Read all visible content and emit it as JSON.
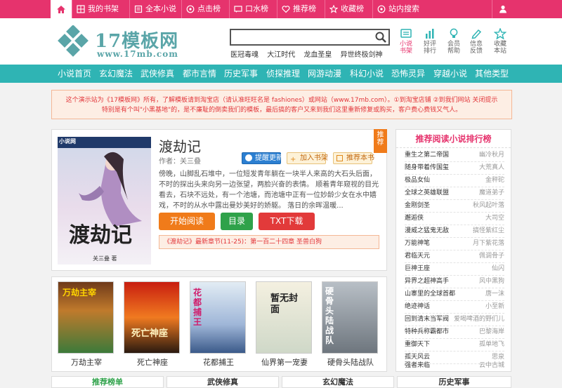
{
  "topnav": {
    "items": [
      {
        "label": "我的书架",
        "icon": "bookshelf-icon"
      },
      {
        "label": "全本小说",
        "icon": "book-icon"
      },
      {
        "label": "点击榜",
        "icon": "click-icon"
      },
      {
        "label": "口水榜",
        "icon": "chat-icon"
      },
      {
        "label": "推荐榜",
        "icon": "heart-icon"
      },
      {
        "label": "收藏榜",
        "icon": "star-icon"
      },
      {
        "label": "站内搜索",
        "icon": "search-icon"
      }
    ]
  },
  "logo": {
    "title": "17模板网",
    "url": "www.17mb.com"
  },
  "search": {
    "value": "",
    "placeholder": ""
  },
  "hotwords": [
    "医冠毒魂",
    "大江时代",
    "龙血圣皇",
    "异世终极剑神"
  ],
  "quicklinks": [
    {
      "line1": "小说",
      "line2": "书架",
      "icon": "bookshelf-icon",
      "color": "#e6336d"
    },
    {
      "line1": "好评",
      "line2": "排行",
      "icon": "bar-chart-icon",
      "color": "#2fb4b4"
    },
    {
      "line1": "会员",
      "line2": "帮助",
      "icon": "bulb-icon",
      "color": "#2fb4b4"
    },
    {
      "line1": "信息",
      "line2": "反馈",
      "icon": "pen-icon",
      "color": "#2fb4b4"
    },
    {
      "line1": "收藏",
      "line2": "本站",
      "icon": "star-icon",
      "color": "#2fb4b4"
    }
  ],
  "categories": [
    "小说首页",
    "玄幻魔法",
    "武侠修真",
    "都市言情",
    "历史军事",
    "侦探推理",
    "网游动漫",
    "科幻小说",
    "恐怖灵异",
    "穿越小说",
    "其他类型"
  ],
  "notice": {
    "line1": "这个演示站为《17模板网》所有，了解模板请到淘宝店（请认准旺旺名是 fashiones）或网站（www.17mb.com）。①到淘宝店铺 ②到我们网站 关闭提示",
    "line2": "特别是有个叫\"小黑基地\"的，是不廉耻的倒卖我们的模板，最后搞的客户又来到我们这里重新修复或购买，客户费心费钱又气人。"
  },
  "book": {
    "title": "渡劫记",
    "author": "作者：关三叠",
    "cover_title": "渡劫记",
    "cover_author": "关三叠 著",
    "cover_site": "小说网",
    "remind_label": "提醒更新",
    "shelf_label": "加入书架",
    "recommend_label": "推荐本书",
    "tag": "推荐",
    "desc": "傍晚，山脚乱石堆中，一位短发青年躺在一块半人来高的大石头后面，不时的探出头来向另一边张望，两脸兴奋的表情。 顺着青年窥视的目光看去，石块不远处，有一个池塘，而池塘中正有一位妙龄少女在水中嬉戏，不时的从水中露出曼妙美好的娇躯。 落日的余晖温暖...",
    "read_label": "开始阅读",
    "toc_label": "目录",
    "txt_label": "TXT下载",
    "latest": "《渡劫记》最新章节(11-25)：第一百二十四章 圣兽白狗"
  },
  "strip": [
    {
      "name": "万劫主宰",
      "cover_text": "万劫主宰"
    },
    {
      "name": "死亡神座",
      "cover_text": "死亡神座"
    },
    {
      "name": "花都捕王",
      "cover_text": "花都捕王"
    },
    {
      "name": "仙界第一宠妻",
      "cover_text": "暂无封面"
    },
    {
      "name": "硬骨头陆战队",
      "cover_text": "硬骨头陆战队"
    }
  ],
  "ranking": {
    "title": "推荐阅读小说排行榜",
    "rows": [
      {
        "title": "重生之第二帝国",
        "author": "幽冷秋月"
      },
      {
        "title": "随身带着传国玺",
        "author": "大荒真人"
      },
      {
        "title": "极品女仙",
        "author": "金秤砣"
      },
      {
        "title": "全球之英雄联盟",
        "author": "魔道弟子"
      },
      {
        "title": "金刚剑圣",
        "author": "秋风起叶落"
      },
      {
        "title": "邂逅侠",
        "author": "大司空"
      },
      {
        "title": "漫威之猛鬼无敌",
        "author": "搞怪紫红尘"
      },
      {
        "title": "万能神笔",
        "author": "月下紫花落"
      },
      {
        "title": "君临天元",
        "author": "佩调骨子"
      },
      {
        "title": "巨神王座",
        "author": "仙闪"
      },
      {
        "title": "异界之超神高手",
        "author": "风中黑狗"
      },
      {
        "title": "山寨里的全球首都",
        "author": "唐一沫"
      },
      {
        "title": "绝迹神话",
        "author": "小至新"
      },
      {
        "title": "回到清末当军阀",
        "author": "爱喝啤酒的野们儿"
      },
      {
        "title": "特种兵称霸都市",
        "author": "巴黎海岸"
      },
      {
        "title": "重御天下",
        "author": "孤单地飞"
      },
      {
        "title": "孤天风云",
        "author": "思泉"
      },
      {
        "title": "强者来临",
        "author": "云中古城"
      }
    ]
  },
  "bottom_tabs": [
    "推荐榜单",
    "武侠修真",
    "玄幻魔法",
    "历史军事"
  ],
  "colors": {
    "pink": "#e6336d",
    "teal": "#2fb4b4",
    "orange": "#f07b1a"
  }
}
